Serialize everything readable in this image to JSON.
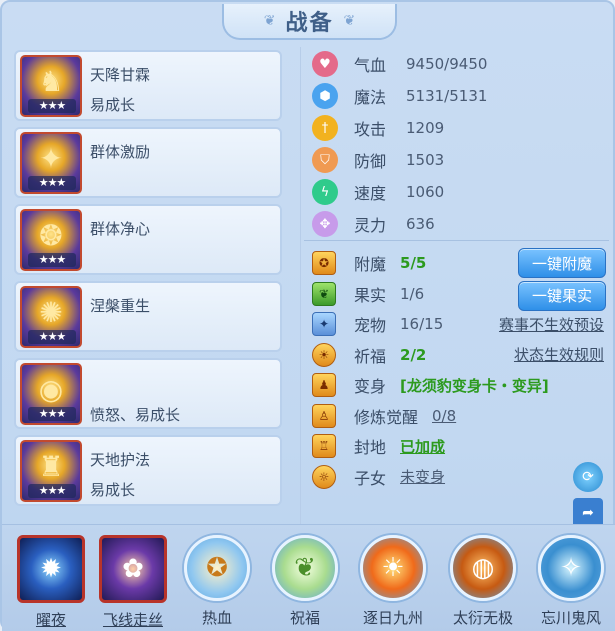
{
  "title": "战备",
  "cards": [
    {
      "name": "天降甘霖",
      "sub": "易成长",
      "stars": "★★★",
      "glyph": "♞",
      "bg": "#3a4fb0"
    },
    {
      "name": "群体激励",
      "sub": "",
      "stars": "★★★",
      "glyph": "✦",
      "bg": "#2d3d9a"
    },
    {
      "name": "群体净心",
      "sub": "",
      "stars": "★★★",
      "glyph": "❂",
      "bg": "#3b4aa6"
    },
    {
      "name": "涅槃重生",
      "sub": "",
      "stars": "★★★",
      "glyph": "✺",
      "bg": "#344cb2"
    },
    {
      "name": "",
      "sub": "愤怒、易成长",
      "stars": "★★★",
      "glyph": "◉",
      "bg": "#2f3c8e"
    },
    {
      "name": "天地护法",
      "sub": "易成长",
      "stars": "★★★",
      "glyph": "♜",
      "bg": "#3a3f8e"
    }
  ],
  "stats": [
    {
      "label": "气血",
      "value": "9450/9450",
      "color": "#e46a8a",
      "glyph": "♥"
    },
    {
      "label": "魔法",
      "value": "5131/5131",
      "color": "#4aa3ef",
      "glyph": "⬢"
    },
    {
      "label": "攻击",
      "value": "1209",
      "color": "#f2b21f",
      "glyph": "†"
    },
    {
      "label": "防御",
      "value": "1503",
      "color": "#f09a52",
      "glyph": "⛉"
    },
    {
      "label": "速度",
      "value": "1060",
      "color": "#2fcb8b",
      "glyph": "ϟ"
    },
    {
      "label": "灵力",
      "value": "636",
      "color": "#c79bea",
      "glyph": "✥"
    }
  ],
  "attrs": {
    "fumo": {
      "label": "附魔",
      "value": "5/5",
      "button": "一键附魔"
    },
    "guoshi": {
      "label": "果实",
      "value": "1/6",
      "button": "一键果实"
    },
    "chongwu": {
      "label": "宠物",
      "value": "16/15",
      "link": "赛事不生效预设"
    },
    "qifu": {
      "label": "祈福",
      "value": "2/2",
      "link": "状态生效规则"
    },
    "bianshen": {
      "label": "变身",
      "value": "[龙须豹变身卡・变异]"
    },
    "xiulian": {
      "label": "修炼觉醒",
      "value": "0/8"
    },
    "fengdi": {
      "label": "封地",
      "value": "已加成"
    },
    "zinv": {
      "label": "子女",
      "value": "未变身"
    }
  },
  "bottom": [
    {
      "label": "曜夜",
      "glyph": "✹",
      "style": "square",
      "color": "#1e3f8a"
    },
    {
      "label": "飞线走丝",
      "glyph": "✿",
      "style": "square",
      "color": "#4b2a8e"
    },
    {
      "label": "热血",
      "glyph": "✪",
      "style": "circle",
      "color": "#e5a43a"
    },
    {
      "label": "祝福",
      "glyph": "❦",
      "style": "circle",
      "color": "#7cc26a"
    },
    {
      "label": "逐日九州",
      "glyph": "☀",
      "style": "circle",
      "color": "#f06a1a"
    },
    {
      "label": "太衍无极",
      "glyph": "◍",
      "style": "circle",
      "color": "#d46a1a"
    },
    {
      "label": "忘川鬼风",
      "glyph": "✧",
      "style": "circle",
      "color": "#3a8fd0"
    }
  ]
}
